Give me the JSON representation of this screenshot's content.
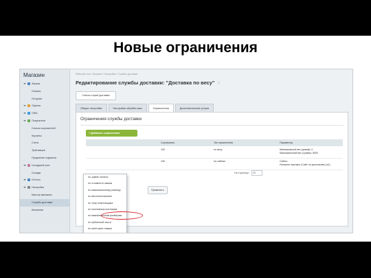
{
  "slide_title": "Новые ограничения",
  "sidebar": {
    "title": "Магазин",
    "items": [
      {
        "label": "Заказы",
        "level": "top",
        "icon": "orders-icon",
        "color": "#4a86c5"
      },
      {
        "label": "Оплаты",
        "level": "sub"
      },
      {
        "label": "Отгрузки",
        "level": "sub"
      },
      {
        "label": "Оценка",
        "level": "top",
        "icon": "rating-icon",
        "color": "#e0a030"
      },
      {
        "label": "CRM",
        "level": "top",
        "icon": "crm-icon",
        "color": "#3a9ad9"
      },
      {
        "label": "Покупатели",
        "level": "top",
        "icon": "customers-icon",
        "color": "#6aa84f"
      },
      {
        "label": "Список покупателей",
        "level": "sub"
      },
      {
        "label": "Корзины",
        "level": "sub"
      },
      {
        "label": "Счета",
        "level": "sub"
      },
      {
        "label": "Транзакции",
        "level": "sub"
      },
      {
        "label": "Продление подписки",
        "level": "sub"
      },
      {
        "label": "Складской учет",
        "level": "top",
        "icon": "warehouse-icon",
        "color": "#c27ba0"
      },
      {
        "label": "Склады",
        "level": "sub"
      },
      {
        "label": "Отчеты",
        "level": "top",
        "icon": "reports-icon",
        "color": "#4a86c5"
      },
      {
        "label": "Настройки",
        "level": "top",
        "icon": "settings-icon",
        "color": "#888888"
      },
      {
        "label": "Мастер магазина",
        "level": "sub"
      },
      {
        "label": "Службы доставки",
        "level": "sub",
        "active": true
      },
      {
        "label": "Компании",
        "level": "sub"
      }
    ]
  },
  "breadcrumb": "Рабочий стол  /  Магазин  /  Настройки  /  Службы доставки",
  "page_title": "Редактирование службы доставки: \"Доставка по весу\"",
  "list_button": "Список служб доставки",
  "tabs": [
    "Общие настройки",
    "Настройки обработчика",
    "Ограничения",
    "Дополнительные услуги"
  ],
  "active_tab": 2,
  "section_title": "Ограничения службы доставки",
  "add_button": "+ Добавить ограничение",
  "table": {
    "headers": [
      "Сортировка",
      "Тип ограничения",
      "Параметры"
    ],
    "rows": [
      {
        "sort": "100",
        "type": "по весу",
        "params": [
          "Минимальный вес (грамм): 0",
          "Максимальный вес (грамм): 5000"
        ]
      },
      {
        "sort": "100",
        "type": "по сайтам",
        "params": [
          "Сайты:",
          "Интернет-магазин (Сайт по умолчанию) (s1)"
        ]
      }
    ]
  },
  "pager_label": "На странице:",
  "pager_value": "20",
  "apply_button": "Применить",
  "dropdown": [
    "по сумме оплаты",
    "по стоимости заказа",
    "по максимальному размеру",
    "по местоположению",
    "по типу плательщика",
    "по платежным системам",
    "по максимальным размерам",
    "по публичной части",
    "по категории товара"
  ],
  "highlight_color": "#d9252c"
}
